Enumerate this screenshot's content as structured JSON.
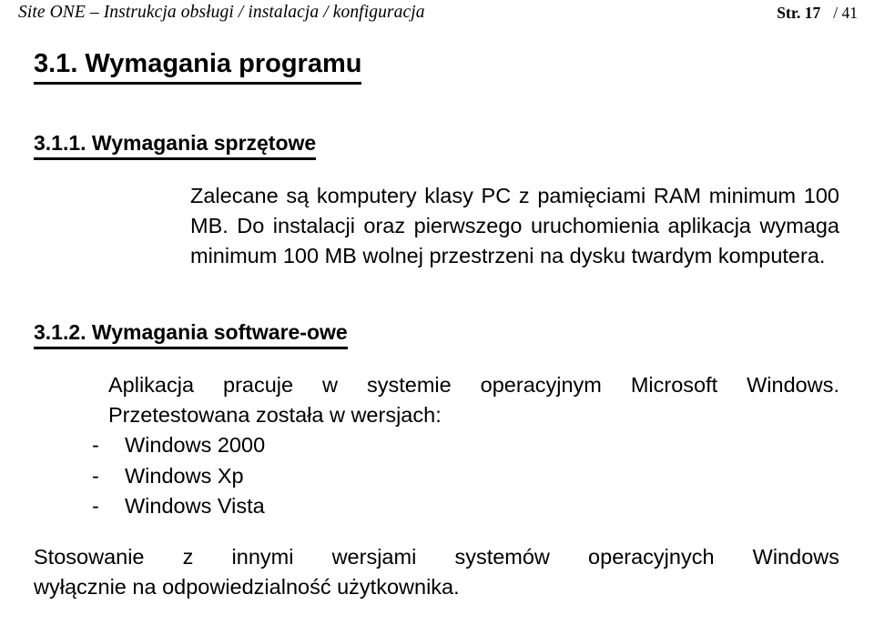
{
  "header": {
    "title": "Site ONE – Instrukcja obsługi / instalacja / konfiguracja",
    "page_label": "Str. 17",
    "page_total": "/ 41"
  },
  "content": {
    "section_heading": "3.1. Wymagania programu",
    "subsections": [
      {
        "heading": "3.1.1. Wymagania sprzętowe",
        "paragraph_lines": [
          "Zalecane są komputery klasy PC z pamięciami RAM minimum 100",
          "MB. Do instalacji oraz pierwszego uruchomienia aplikacja wymaga",
          "minimum 100 MB wolnej przestrzeni na dysku twardym komputera."
        ]
      },
      {
        "heading": "3.1.2. Wymagania software-owe",
        "paragraph_lines": [
          "Aplikacja pracuje w systemie operacyjnym Microsoft Windows.",
          "Przetestowana została w wersjach:"
        ],
        "list_dash": "-",
        "list_items": [
          "Windows 2000",
          "Windows Xp",
          "Windows Vista"
        ],
        "closing_lines": [
          "Stosowanie z innymi wersjami systemów operacyjnych Windows",
          "wyłącznie na odpowiedzialność użytkownika."
        ]
      }
    ]
  }
}
